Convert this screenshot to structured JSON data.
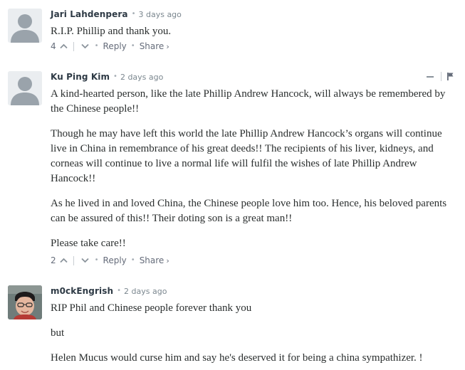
{
  "comments": [
    {
      "author": "Jari Lahdenpera",
      "time": "3 days ago",
      "paragraphs": [
        "R.I.P. Phillip and thank you."
      ],
      "votes": "4",
      "reply_label": "Reply",
      "share_label": "Share",
      "avatar": "default-avatar-icon"
    },
    {
      "author": "Ku Ping Kim",
      "time": "2 days ago",
      "paragraphs": [
        "A kind-hearted person, like the late Phillip Andrew Hancock, will always be remembered by the Chinese people!!",
        "Though he may have left this world the late Phillip Andrew Hancock’s organs will continue live in China in remembrance of his great deeds!! The recipients of his liver, kidneys, and corneas will continue to live a normal life will fulfil the wishes of late Phillip Andrew Hancock!!",
        "As he lived in and loved China, the Chinese people love him too. Hence, his beloved parents can be assured of this!! Their doting son is a great man!!",
        "Please take care!!"
      ],
      "votes": "2",
      "reply_label": "Reply",
      "share_label": "Share",
      "avatar": "default-avatar-icon"
    },
    {
      "author": "m0ckEngrish",
      "time": "2 days ago",
      "paragraphs": [
        "RIP Phil and Chinese people forever thank you",
        "but",
        "Helen Mucus would curse him and say he's deserved it for being a china sympathizer. !"
      ],
      "avatar": "user-photo-avatar"
    }
  ],
  "icons": {
    "upvote": "chevron-up-icon",
    "downvote": "chevron-down-icon",
    "share_chevron": "chevron-right-icon",
    "collapse": "minus-icon",
    "flag": "flag-icon"
  },
  "colors": {
    "author": "#2e3a45",
    "meta": "#7b878f",
    "body_text": "#2a2e2e",
    "actions": "#656c7a",
    "avatar_placeholder_bg": "#eaedf0",
    "avatar_placeholder_fg": "#9aa3ab"
  }
}
